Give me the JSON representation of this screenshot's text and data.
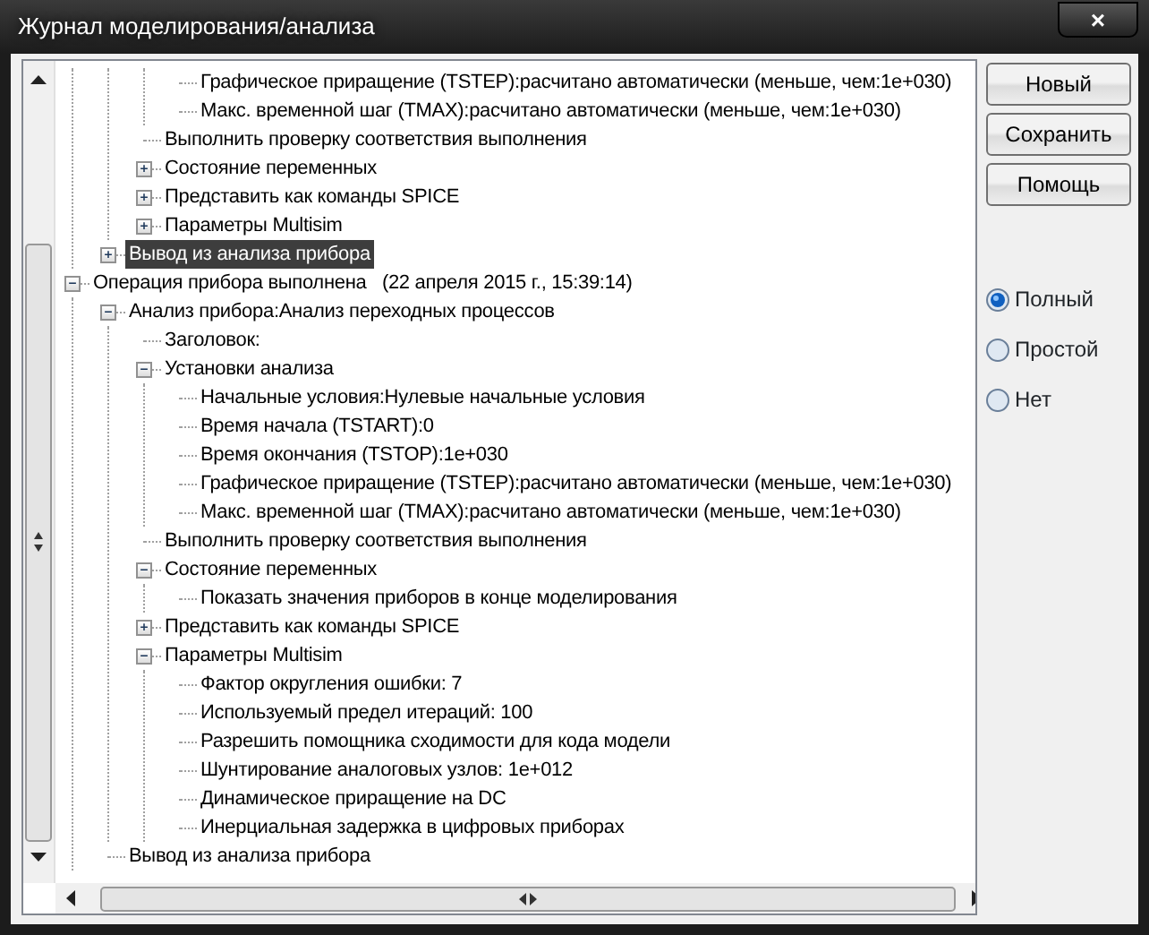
{
  "window": {
    "title": "Журнал моделирования/анализа",
    "close": "×"
  },
  "tree": [
    {
      "children": [
        {
          "children": [
            {
              "children": [
                {
                  "label": "Графическое приращение (TSTEP):расчитано автоматически (меньше, чем:1е+030)",
                  "selected": false
                },
                {
                  "label": "Макс. временной шаг (TMAX):расчитано автоматически (меньше, чем:1е+030)",
                  "selected": false
                }
              ]
            },
            {
              "label": "Выполнить проверку соответствия выполнения",
              "selected": false
            },
            {
              "label": "Состояние переменных",
              "selected": false,
              "expanded": false
            },
            {
              "label": "Представить как команды SPICE",
              "selected": false,
              "expanded": false
            },
            {
              "label": "Параметры Multisim",
              "selected": false,
              "expanded": false
            }
          ]
        },
        {
          "label": "Вывод из анализа прибора",
          "selected": true,
          "expanded": false
        }
      ]
    },
    {
      "label": "Операция прибора выполнена   (22 апреля 2015 г., 15:39:14)",
      "selected": false,
      "expanded": true,
      "children": [
        {
          "label": "Анализ прибора:Анализ переходных процессов",
          "selected": false,
          "expanded": true,
          "children": [
            {
              "label": "Заголовок:",
              "selected": false
            },
            {
              "label": "Установки анализа",
              "selected": false,
              "expanded": true,
              "children": [
                {
                  "label": "Начальные условия:Нулевые начальные условия",
                  "selected": false
                },
                {
                  "label": "Время начала (TSTART):0",
                  "selected": false
                },
                {
                  "label": "Время окончания (TSTOP):1е+030",
                  "selected": false
                },
                {
                  "label": "Графическое приращение (TSTEP):расчитано автоматически (меньше, чем:1е+030)",
                  "selected": false
                },
                {
                  "label": "Макс. временной шаг (TMAX):расчитано автоматически (меньше, чем:1е+030)",
                  "selected": false
                }
              ]
            },
            {
              "label": "Выполнить проверку соответствия выполнения",
              "selected": false
            },
            {
              "label": "Состояние переменных",
              "selected": false,
              "expanded": true,
              "children": [
                {
                  "label": "Показать значения приборов в конце моделирования",
                  "selected": false
                }
              ]
            },
            {
              "label": "Представить как команды SPICE",
              "selected": false,
              "expanded": false
            },
            {
              "label": "Параметры Multisim",
              "selected": false,
              "expanded": true,
              "children": [
                {
                  "label": "Фактор округления ошибки: 7",
                  "selected": false
                },
                {
                  "label": "Используемый предел итераций: 100",
                  "selected": false
                },
                {
                  "label": "Разрешить помощника сходимости для кода модели",
                  "selected": false
                },
                {
                  "label": "Шунтирование аналоговых узлов: 1е+012",
                  "selected": false
                },
                {
                  "label": "Динамическое приращение на DC",
                  "selected": false
                },
                {
                  "label": "Инерциальная задержка в цифровых приборах",
                  "selected": false
                }
              ]
            }
          ]
        },
        {
          "label": "Вывод из анализа прибора",
          "selected": false
        }
      ]
    }
  ],
  "buttons": [
    "Новый",
    "Сохранить",
    "Помощь"
  ],
  "options": [
    {
      "label": "Полный",
      "selected": true
    },
    {
      "label": "Простой",
      "selected": false
    },
    {
      "label": "Нет",
      "selected": false
    }
  ]
}
